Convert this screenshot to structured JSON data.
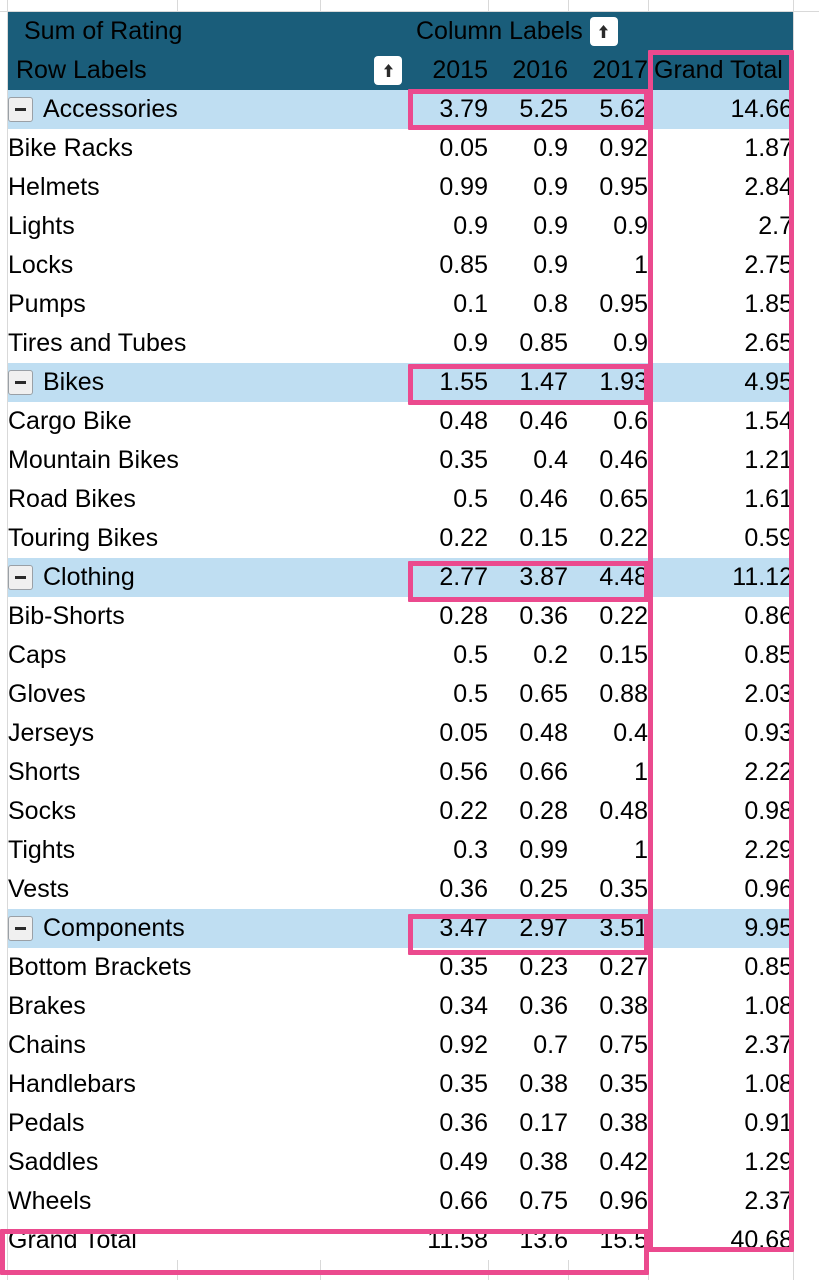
{
  "table": {
    "value_field_label": "Sum of Rating",
    "column_labels_label": "Column Labels",
    "row_labels_label": "Row Labels",
    "grand_total_header": "Grand Total",
    "grand_total_row_label": "Grand Total",
    "years": [
      "2015",
      "2016",
      "2017"
    ],
    "colors": {
      "header_background": "#1a5d7a",
      "header_text": "#ffffff",
      "category_row_background": "#bfdef2",
      "item_row_background": "#ffffff",
      "highlight_border": "#eb4a8e",
      "gridline": "#d9d9d9",
      "body_text": "#000000"
    },
    "icons": {
      "filter_arrow": "up-arrow-icon",
      "collapse": "minus-icon"
    },
    "rows": [
      {
        "type": "category",
        "label": "Accessories",
        "values": [
          "3.79",
          "5.25",
          "5.62"
        ],
        "total": "14.66"
      },
      {
        "type": "item",
        "label": "Bike Racks",
        "values": [
          "0.05",
          "0.9",
          "0.92"
        ],
        "total": "1.87"
      },
      {
        "type": "item",
        "label": "Helmets",
        "values": [
          "0.99",
          "0.9",
          "0.95"
        ],
        "total": "2.84"
      },
      {
        "type": "item",
        "label": "Lights",
        "values": [
          "0.9",
          "0.9",
          "0.9"
        ],
        "total": "2.7"
      },
      {
        "type": "item",
        "label": "Locks",
        "values": [
          "0.85",
          "0.9",
          "1"
        ],
        "total": "2.75"
      },
      {
        "type": "item",
        "label": "Pumps",
        "values": [
          "0.1",
          "0.8",
          "0.95"
        ],
        "total": "1.85"
      },
      {
        "type": "item",
        "label": "Tires and Tubes",
        "values": [
          "0.9",
          "0.85",
          "0.9"
        ],
        "total": "2.65"
      },
      {
        "type": "category",
        "label": "Bikes",
        "values": [
          "1.55",
          "1.47",
          "1.93"
        ],
        "total": "4.95"
      },
      {
        "type": "item",
        "label": "Cargo Bike",
        "values": [
          "0.48",
          "0.46",
          "0.6"
        ],
        "total": "1.54"
      },
      {
        "type": "item",
        "label": "Mountain Bikes",
        "values": [
          "0.35",
          "0.4",
          "0.46"
        ],
        "total": "1.21"
      },
      {
        "type": "item",
        "label": "Road Bikes",
        "values": [
          "0.5",
          "0.46",
          "0.65"
        ],
        "total": "1.61"
      },
      {
        "type": "item",
        "label": "Touring Bikes",
        "values": [
          "0.22",
          "0.15",
          "0.22"
        ],
        "total": "0.59"
      },
      {
        "type": "category",
        "label": "Clothing",
        "values": [
          "2.77",
          "3.87",
          "4.48"
        ],
        "total": "11.12"
      },
      {
        "type": "item",
        "label": "Bib-Shorts",
        "values": [
          "0.28",
          "0.36",
          "0.22"
        ],
        "total": "0.86"
      },
      {
        "type": "item",
        "label": "Caps",
        "values": [
          "0.5",
          "0.2",
          "0.15"
        ],
        "total": "0.85"
      },
      {
        "type": "item",
        "label": "Gloves",
        "values": [
          "0.5",
          "0.65",
          "0.88"
        ],
        "total": "2.03"
      },
      {
        "type": "item",
        "label": "Jerseys",
        "values": [
          "0.05",
          "0.48",
          "0.4"
        ],
        "total": "0.93"
      },
      {
        "type": "item",
        "label": "Shorts",
        "values": [
          "0.56",
          "0.66",
          "1"
        ],
        "total": "2.22"
      },
      {
        "type": "item",
        "label": "Socks",
        "values": [
          "0.22",
          "0.28",
          "0.48"
        ],
        "total": "0.98"
      },
      {
        "type": "item",
        "label": "Tights",
        "values": [
          "0.3",
          "0.99",
          "1"
        ],
        "total": "2.29"
      },
      {
        "type": "item",
        "label": "Vests",
        "values": [
          "0.36",
          "0.25",
          "0.35"
        ],
        "total": "0.96"
      },
      {
        "type": "category",
        "label": "Components",
        "values": [
          "3.47",
          "2.97",
          "3.51"
        ],
        "total": "9.95"
      },
      {
        "type": "item",
        "label": "Bottom Brackets",
        "values": [
          "0.35",
          "0.23",
          "0.27"
        ],
        "total": "0.85"
      },
      {
        "type": "item",
        "label": "Brakes",
        "values": [
          "0.34",
          "0.36",
          "0.38"
        ],
        "total": "1.08"
      },
      {
        "type": "item",
        "label": "Chains",
        "values": [
          "0.92",
          "0.7",
          "0.75"
        ],
        "total": "2.37"
      },
      {
        "type": "item",
        "label": "Handlebars",
        "values": [
          "0.35",
          "0.38",
          "0.35"
        ],
        "total": "1.08"
      },
      {
        "type": "item",
        "label": "Pedals",
        "values": [
          "0.36",
          "0.17",
          "0.38"
        ],
        "total": "0.91"
      },
      {
        "type": "item",
        "label": "Saddles",
        "values": [
          "0.49",
          "0.38",
          "0.42"
        ],
        "total": "1.29"
      },
      {
        "type": "item",
        "label": "Wheels",
        "values": [
          "0.66",
          "0.75",
          "0.96"
        ],
        "total": "2.37"
      },
      {
        "type": "total",
        "label": "Grand Total",
        "values": [
          "11.58",
          "13.6",
          "15.5"
        ],
        "total": "40.68"
      }
    ]
  },
  "chart_data": {
    "type": "table",
    "title": "Sum of Rating",
    "categories": [
      "Accessories",
      "Bikes",
      "Clothing",
      "Components",
      "Grand Total"
    ],
    "series": [
      {
        "name": "2015",
        "values": [
          3.79,
          1.55,
          2.77,
          3.47,
          11.58
        ]
      },
      {
        "name": "2016",
        "values": [
          5.25,
          1.47,
          3.87,
          2.97,
          13.6
        ]
      },
      {
        "name": "2017",
        "values": [
          5.62,
          1.93,
          4.48,
          3.51,
          15.5
        ]
      },
      {
        "name": "Grand Total",
        "values": [
          14.66,
          4.95,
          11.12,
          9.95,
          40.68
        ]
      }
    ],
    "xlabel": "Row Labels",
    "ylabel": "Sum of Rating"
  }
}
